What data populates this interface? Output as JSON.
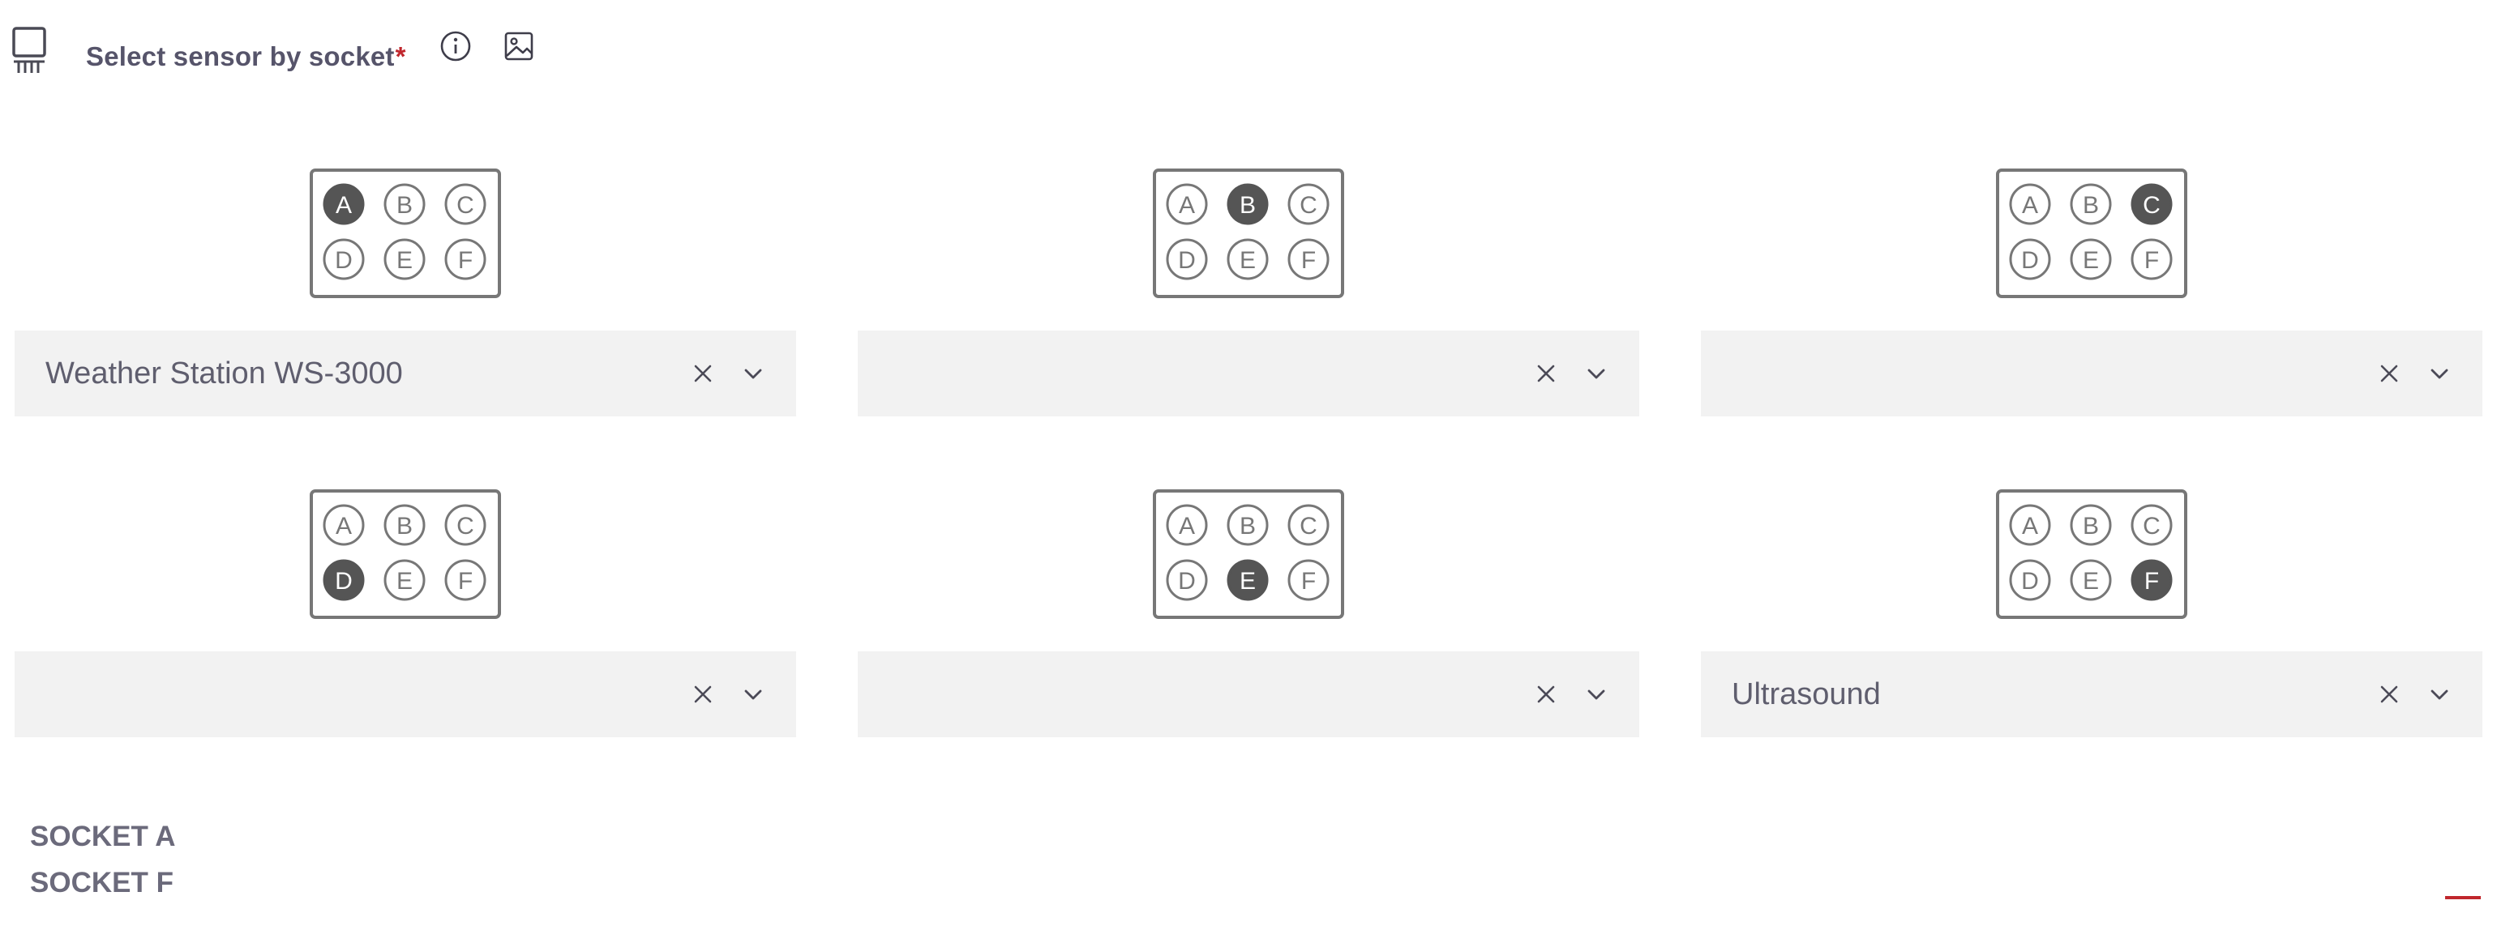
{
  "header": {
    "title": "Select sensor by socket",
    "required_marker": "*",
    "icons": [
      "sensor-icon",
      "info-icon",
      "image-icon"
    ]
  },
  "socket_letters": [
    "A",
    "B",
    "C",
    "D",
    "E",
    "F"
  ],
  "sockets": [
    {
      "active": "A",
      "value": "Weather Station WS-3000"
    },
    {
      "active": "B",
      "value": ""
    },
    {
      "active": "C",
      "value": ""
    },
    {
      "active": "D",
      "value": ""
    },
    {
      "active": "E",
      "value": ""
    },
    {
      "active": "F",
      "value": "Ultrasound"
    }
  ],
  "summary": [
    "SOCKET A",
    "SOCKET F"
  ],
  "colors": {
    "text": "#56546a",
    "active_socket": "#555555",
    "select_bg": "#f2f2f2",
    "required": "#c0272d"
  }
}
